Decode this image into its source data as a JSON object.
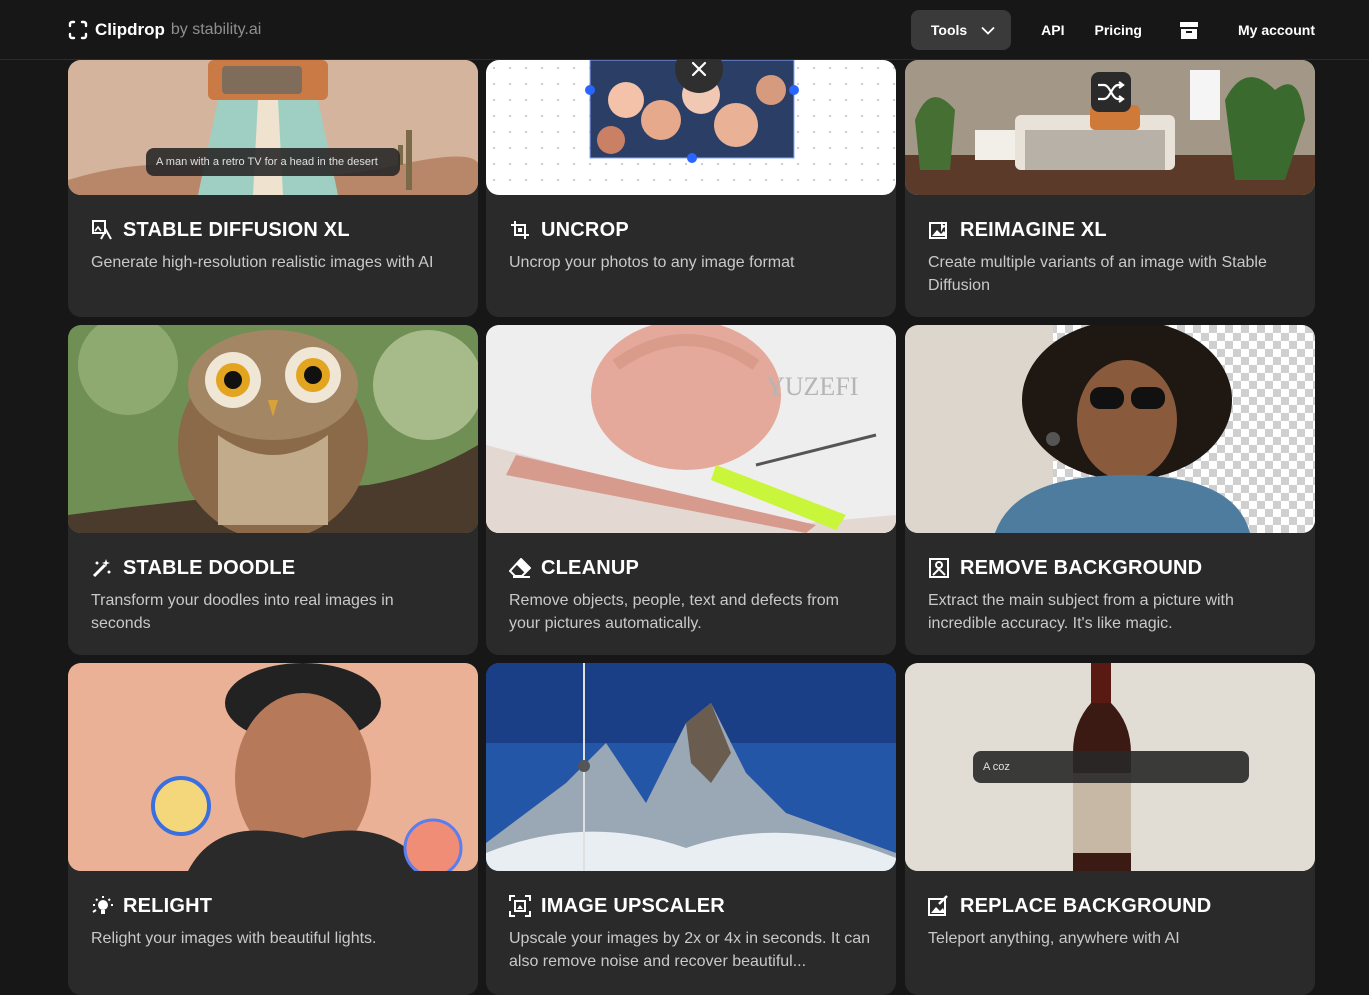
{
  "brand": {
    "name": "Clipdrop",
    "by": "by stability.ai"
  },
  "nav": {
    "tools": "Tools",
    "api": "API",
    "pricing": "Pricing",
    "account": "My account"
  },
  "cards": [
    {
      "title": "STABLE DIFFUSION XL",
      "desc": "Generate high-resolution realistic images with AI",
      "caption": "A man with a retro TV for a head in the desert",
      "icon": "image-text-icon"
    },
    {
      "title": "UNCROP",
      "desc": "Uncrop your photos to any image format",
      "icon": "crop-icon"
    },
    {
      "title": "REIMAGINE XL",
      "desc": "Create multiple variants of an image with Stable Diffusion",
      "icon": "reimagine-icon"
    },
    {
      "title": "STABLE DOODLE",
      "desc": "Transform your doodles into real images in seconds",
      "icon": "magic-wand-icon"
    },
    {
      "title": "CLEANUP",
      "desc": "Remove objects, people, text and defects from your pictures automatically.",
      "icon": "eraser-icon"
    },
    {
      "title": "REMOVE BACKGROUND",
      "desc": "Extract the main subject from a picture with incredible accuracy. It's like magic.",
      "icon": "remove-bg-icon"
    },
    {
      "title": "RELIGHT",
      "desc": "Relight your images with beautiful lights.",
      "icon": "bulb-icon"
    },
    {
      "title": "IMAGE UPSCALER",
      "desc": "Upscale your images by 2x or 4x in seconds. It can also remove noise and recover beautiful...",
      "icon": "upscale-icon"
    },
    {
      "title": "REPLACE BACKGROUND",
      "desc": "Teleport anything, anywhere with AI",
      "caption": "A coz",
      "icon": "replace-bg-icon"
    }
  ],
  "colors": {
    "background": "#171717",
    "card": "#2a2a2a",
    "nav_active": "#3a3a3a"
  }
}
